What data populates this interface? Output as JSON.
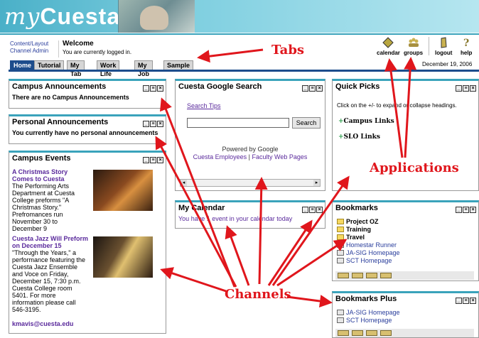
{
  "header": {
    "logo_prefix": "my",
    "logo_name": "Cuesta"
  },
  "welcome": {
    "links": [
      "Content/Layout",
      "Channel Admin"
    ],
    "title": "Welcome",
    "subtitle": "You are currently logged in."
  },
  "apps": [
    {
      "label": "calendar",
      "icon": "calendar-icon"
    },
    {
      "label": "groups",
      "icon": "groups-icon"
    },
    {
      "label": "logout",
      "icon": "logout-icon"
    },
    {
      "label": "help",
      "icon": "help-icon"
    }
  ],
  "tabs": [
    "Home",
    "Tutorial",
    "My Tab",
    "Work Life",
    "My Job",
    "Sample"
  ],
  "active_tab": "Home",
  "date": "December 19, 2006",
  "channels": {
    "campus_announcements": {
      "title": "Campus Announcements",
      "text": "There are no Campus Announcements"
    },
    "personal_announcements": {
      "title": "Personal Announcements",
      "text": "You currently have no personal announcements"
    },
    "campus_events": {
      "title": "Campus Events",
      "events": [
        {
          "title": "A Christmas Story Comes to Cuesta",
          "text": "The Performing Arts Department at Cuesta College preforms \"A Christmas Story.\" Prefromances run November 30 to December 9"
        },
        {
          "title": "Cuesta Jazz Will Preform on December 15",
          "text": "\"Through the Years,\" a performance featuring the Cuesta Jazz Ensemble and Voce on Friday, December 15, 7:30 p.m. Cuesta College room 5401. For more information please call 546-3195."
        }
      ],
      "contact": "kmavis@cuesta.edu"
    },
    "google_search": {
      "title": "Cuesta Google Search",
      "tips": "Search Tips",
      "button": "Search",
      "powered": "Powered by Google",
      "links": [
        "Cuesta Employees",
        "Faculty Web Pages"
      ],
      "separator": "|"
    },
    "my_calendar": {
      "title": "My Calendar",
      "text": "You have 1 event in your calendar today"
    },
    "quick_picks": {
      "title": "Quick Picks",
      "instruction": "Click on the +/- to expand or collapse headings.",
      "links": [
        "Campus Links",
        "SLO Links"
      ]
    },
    "bookmarks": {
      "title": "Bookmarks",
      "folders": [
        "Project OZ",
        "Training",
        "Travel"
      ],
      "links": [
        "Homestar Runner",
        "JA-SIG Homepage",
        "SCT Homepage"
      ]
    },
    "bookmarks_plus": {
      "title": "Bookmarks Plus",
      "links": [
        "JA-SIG Homepage",
        "SCT Homepage"
      ]
    }
  },
  "annotations": {
    "tabs": "Tabs",
    "applications": "Applications",
    "channels": "Channels"
  },
  "colors": {
    "accent": "#3aa3bb",
    "tab_active": "#1d4d8c",
    "annotation": "#e0161c",
    "link": "#2a3e9c"
  }
}
